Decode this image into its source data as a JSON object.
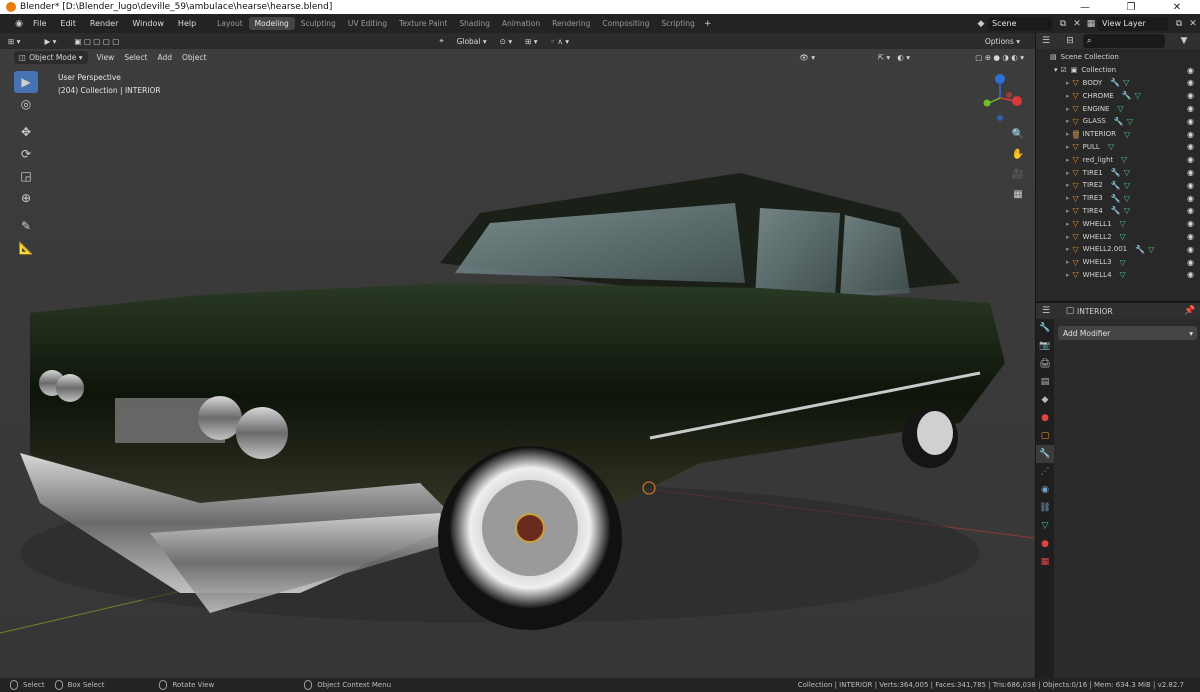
{
  "window": {
    "title": "Blender* [D:\\Blender_lugo\\deville_59\\ambulace\\hearse\\hearse.blend]",
    "minimize": "—",
    "maximize": "❐",
    "close": "✕"
  },
  "menu": [
    "File",
    "Edit",
    "Render",
    "Window",
    "Help"
  ],
  "workspaces": [
    "Layout",
    "Modeling",
    "Sculpting",
    "UV Editing",
    "Texture Paint",
    "Shading",
    "Animation",
    "Rendering",
    "Compositing",
    "Scripting"
  ],
  "active_workspace": "Modeling",
  "scene": "Scene",
  "view_layer": "View Layer",
  "viewport": {
    "mode": "Object Mode",
    "menus": [
      "View",
      "Select",
      "Add",
      "Object"
    ],
    "orientation": "Global",
    "options_label": "Options",
    "info_line1": "User Perspective",
    "info_line2": "(204) Collection | INTERIOR"
  },
  "outliner": {
    "scene_collection": "Scene Collection",
    "collection": "Collection",
    "objects": [
      {
        "name": "BODY",
        "modifier": true
      },
      {
        "name": "CHROME",
        "modifier": true
      },
      {
        "name": "ENGINE",
        "modifier": false
      },
      {
        "name": "GLASS",
        "modifier": true
      },
      {
        "name": "INTERIOR",
        "modifier": false,
        "selected": true
      },
      {
        "name": "PULL",
        "modifier": false
      },
      {
        "name": "red_light",
        "modifier": false
      },
      {
        "name": "TIRE1",
        "modifier": true
      },
      {
        "name": "TIRE2",
        "modifier": true
      },
      {
        "name": "TIRE3",
        "modifier": true
      },
      {
        "name": "TIRE4",
        "modifier": true
      },
      {
        "name": "WHELL1",
        "modifier": false
      },
      {
        "name": "WHELL2",
        "modifier": false
      },
      {
        "name": "WHELL2.001",
        "modifier": true
      },
      {
        "name": "WHELL3",
        "modifier": false
      },
      {
        "name": "WHELL4",
        "modifier": false
      }
    ]
  },
  "properties": {
    "object_name": "INTERIOR",
    "add_modifier": "Add Modifier"
  },
  "statusbar": {
    "select": "Select",
    "box_select": "Box Select",
    "rotate_view": "Rotate View",
    "context_menu": "Object Context Menu",
    "stats": "Collection | INTERIOR | Verts:364,005 | Faces:341,785 | Tris:686,038 | Objects:0/16 | Mem: 634.3 MiB | v2.82.7"
  },
  "colors": {
    "accent": "#4772b3",
    "object_orange": "#e58f2a",
    "mesh_green": "#4fc48a",
    "viewport_bg": "#3c3c3c"
  }
}
